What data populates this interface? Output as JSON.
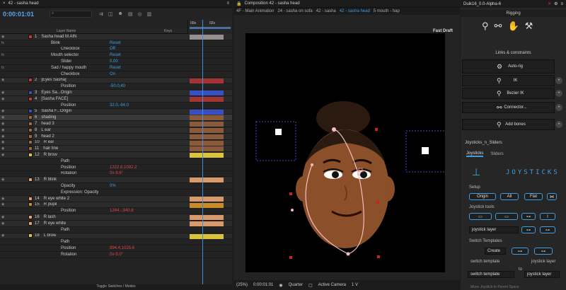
{
  "timeline": {
    "tab_title": "42 - sasha head",
    "timecode": "0:00:01:01",
    "header": {
      "layer_name": "Layer Name",
      "keys": "Keys"
    },
    "ruler": {
      "t1": "00s",
      "t2": "02s"
    },
    "rows": [
      {
        "num": "1",
        "name": "Sasha head M AIN",
        "val": "",
        "type": "layer",
        "color": "#c23b3b",
        "bar": "#9a8f8f"
      },
      {
        "num": "",
        "name": "Blink",
        "val": "Reset",
        "type": "fx"
      },
      {
        "num": "",
        "name": "Checkbox",
        "val": "Off",
        "type": "prop"
      },
      {
        "num": "",
        "name": "Mouth selector",
        "val": "Reset",
        "type": "fx"
      },
      {
        "num": "",
        "name": "Slider",
        "val": "0.00",
        "type": "prop"
      },
      {
        "num": "",
        "name": "Sad / happy mouth",
        "val": "Reset",
        "type": "fx"
      },
      {
        "num": "",
        "name": "Checkbox",
        "val": "On",
        "type": "prop"
      },
      {
        "num": "2",
        "name": "[Eyes Sasha]",
        "val": "",
        "type": "layer",
        "color": "#c23b3b",
        "bar": "#a23434"
      },
      {
        "num": "",
        "name": "Position",
        "val": "-50.0,40",
        "type": "prop"
      },
      {
        "num": "3",
        "name": "Eyes Sa...Origin",
        "val": "",
        "type": "layer",
        "color": "#3a4fc2",
        "bar": "#3a4fc2"
      },
      {
        "num": "4",
        "name": "[Sasha FACE]",
        "val": "",
        "type": "layer",
        "color": "#c23b3b",
        "bar": "#a23434"
      },
      {
        "num": "",
        "name": "Position",
        "val": "32.0,-84.0",
        "type": "prop"
      },
      {
        "num": "5",
        "name": "Sasha F...Origin",
        "val": "",
        "type": "layer",
        "color": "#3a4fc2",
        "bar": "#3a4fc2"
      },
      {
        "num": "6",
        "name": "shading",
        "val": "",
        "type": "layer",
        "color": "#9c6a45",
        "bar": "#8a5a3a",
        "selected": true
      },
      {
        "num": "7",
        "name": "head 3",
        "val": "",
        "type": "layer",
        "color": "#9c6a45",
        "bar": "#8a5a3a"
      },
      {
        "num": "8",
        "name": "L ear",
        "val": "",
        "type": "layer",
        "color": "#9c6a45",
        "bar": "#8a5a3a"
      },
      {
        "num": "9",
        "name": "head 2",
        "val": "",
        "type": "layer",
        "color": "#9c6a45",
        "bar": "#8a5a3a"
      },
      {
        "num": "10",
        "name": "R ear",
        "val": "",
        "type": "layer",
        "color": "#9c6a45",
        "bar": "#8a5a3a"
      },
      {
        "num": "11",
        "name": "hair line",
        "val": "",
        "type": "layer",
        "color": "#9c6a45",
        "bar": "#8a5a3a"
      },
      {
        "num": "12",
        "name": "R brow",
        "val": "",
        "type": "layer",
        "color": "#d9c43b",
        "bar": "#d9c43b"
      },
      {
        "num": "",
        "name": "Path",
        "val": "",
        "type": "prop"
      },
      {
        "num": "",
        "name": "Position",
        "val": "1222.8,1092.2",
        "type": "prop",
        "red": true
      },
      {
        "num": "",
        "name": "Rotation",
        "val": "0x-9.6°",
        "type": "prop",
        "red": true
      },
      {
        "num": "13",
        "name": "R blink",
        "val": "",
        "type": "layer",
        "color": "#e0a070",
        "bar": "#d89a6a"
      },
      {
        "num": "",
        "name": "Opacity",
        "val": "0%",
        "type": "prop"
      },
      {
        "num": "",
        "name": "Expression: Opacity",
        "val": "",
        "type": "prop"
      },
      {
        "num": "14",
        "name": "R eye white 2",
        "val": "",
        "type": "layer",
        "color": "#e0a070",
        "bar": "#d89a6a"
      },
      {
        "num": "15",
        "name": "R pupil",
        "val": "",
        "type": "layer",
        "color": "#c98a2a",
        "bar": "#c98a2a"
      },
      {
        "num": "",
        "name": "Position",
        "val": "1244.-.840.8",
        "type": "prop",
        "red": true
      },
      {
        "num": "16",
        "name": "R lash",
        "val": "",
        "type": "layer",
        "color": "#e0a070",
        "bar": "#d89a6a"
      },
      {
        "num": "17",
        "name": "R eye white",
        "val": "",
        "type": "layer",
        "color": "#e0a070",
        "bar": "#d89a6a"
      },
      {
        "num": "",
        "name": "Path",
        "val": "",
        "type": "prop"
      },
      {
        "num": "18",
        "name": "L brow",
        "val": "",
        "type": "layer",
        "color": "#d9c43b",
        "bar": "#d9c43b"
      },
      {
        "num": "",
        "name": "Path",
        "val": "",
        "type": "prop"
      },
      {
        "num": "",
        "name": "Position",
        "val": "894.4,1025.6",
        "type": "prop",
        "red": true
      },
      {
        "num": "",
        "name": "Rotation",
        "val": "0x-5.0°",
        "type": "prop",
        "red": true
      }
    ],
    "footer": "Toggle Switches / Modes"
  },
  "composition": {
    "tab_title": "Composition 42 - sasha head",
    "breadcrumbs": [
      "4F - Main Animation",
      "24 - sasha on sofa",
      "42 - sasha",
      "42 - sasha head",
      "5 mouth - hap"
    ],
    "active_breadcrumb": 3,
    "fast_draft": "Fast Draft",
    "footer": {
      "zoom": "(25%)",
      "time": "0:00:01:01",
      "resolution": "Quarter",
      "camera": "Active Camera",
      "views": "1 V"
    }
  },
  "duik": {
    "title": "Duik16_0.0-Alpha-6",
    "rigging": "Rigging",
    "links_label": "Links & constraints",
    "buttons": [
      "Auto-rig",
      "IK",
      "Bezier IK",
      "Connector...",
      "Add bones"
    ],
    "joysticks_section": "Joysticks_n_Sliders",
    "tabs": [
      "Joysticks",
      "Sliders"
    ],
    "banner": "JOYSTICKS",
    "setup_label": "Setup",
    "setup": {
      "origin": "Origin",
      "all": "All",
      "flat": "Flat"
    },
    "tools_label": "Joystick tools",
    "joystick_layer": "joystick layer",
    "switch_templates_label": "Switch Templates",
    "create": "Create",
    "switch_template": "switch template",
    "to": "to",
    "switch_template_select": "switch template",
    "joystick_layer2": "joystick layer",
    "bottom_hint": "Move Joystick to Parent Space"
  }
}
